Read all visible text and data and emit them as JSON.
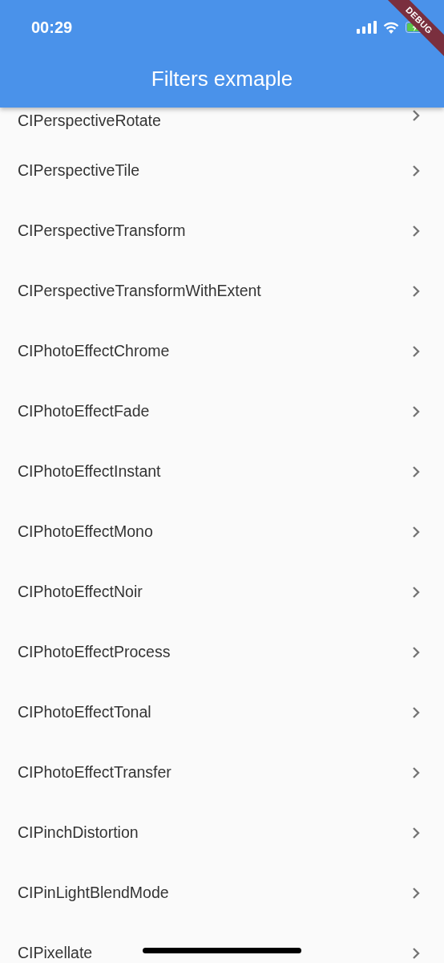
{
  "status_bar": {
    "time": "00:29"
  },
  "app_bar": {
    "title": "Filters exmaple"
  },
  "debug_banner": {
    "label": "DEBUG"
  },
  "filters": [
    {
      "label": "CIPerspectiveRotate"
    },
    {
      "label": "CIPerspectiveTile"
    },
    {
      "label": "CIPerspectiveTransform"
    },
    {
      "label": "CIPerspectiveTransformWithExtent"
    },
    {
      "label": "CIPhotoEffectChrome"
    },
    {
      "label": "CIPhotoEffectFade"
    },
    {
      "label": "CIPhotoEffectInstant"
    },
    {
      "label": "CIPhotoEffectMono"
    },
    {
      "label": "CIPhotoEffectNoir"
    },
    {
      "label": "CIPhotoEffectProcess"
    },
    {
      "label": "CIPhotoEffectTonal"
    },
    {
      "label": "CIPhotoEffectTransfer"
    },
    {
      "label": "CIPinchDistortion"
    },
    {
      "label": "CIPinLightBlendMode"
    },
    {
      "label": "CIPixellate"
    }
  ]
}
